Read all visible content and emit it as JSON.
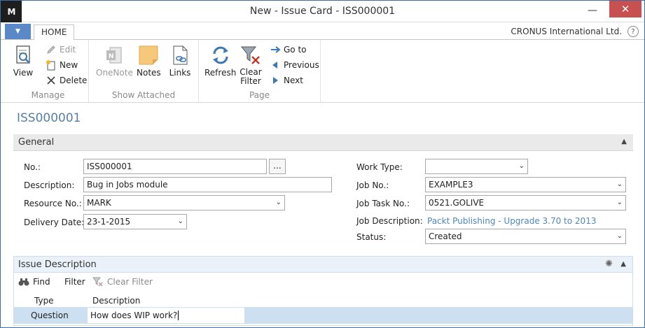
{
  "window": {
    "title": "New - Issue Card - ISS000001",
    "logo": "M",
    "minimize_icon": "minimize-icon",
    "close_icon": "close-icon"
  },
  "ribbon": {
    "file_tab": "▼",
    "home_tab": "HOME",
    "company": "CRONUS International Ltd.",
    "help": "?",
    "groups": {
      "manage": {
        "label": "Manage",
        "view": "View",
        "edit": "Edit",
        "new": "New",
        "delete": "Delete"
      },
      "show_attached": {
        "label": "Show Attached",
        "onenote": "OneNote",
        "notes": "Notes",
        "links": "Links"
      },
      "page": {
        "label": "Page",
        "refresh": "Refresh",
        "clear_filter_1": "Clear",
        "clear_filter_2": "Filter",
        "go_to": "Go to",
        "previous": "Previous",
        "next": "Next"
      }
    }
  },
  "page": {
    "heading": "ISS000001"
  },
  "general": {
    "title": "General",
    "fields": {
      "no_label": "No.:",
      "no_value": "ISS000001",
      "assist": "...",
      "description_label": "Description:",
      "description_value": "Bug in Jobs module",
      "resource_label": "Resource No.:",
      "resource_value": "MARK",
      "delivery_label": "Delivery Date:",
      "delivery_value": "23-1-2015",
      "work_type_label": "Work Type:",
      "work_type_value": "",
      "job_no_label": "Job No.:",
      "job_no_value": "EXAMPLE3",
      "job_task_label": "Job Task No.:",
      "job_task_value": "0521.GOLIVE",
      "job_desc_label": "Job Description:",
      "job_desc_value": "Packt Publishing - Upgrade 3.70 to 2013",
      "status_label": "Status:",
      "status_value": "Created"
    }
  },
  "issue_description": {
    "title": "Issue Description",
    "actions": {
      "find": "Find",
      "filter": "Filter",
      "clear_filter": "Clear Filter"
    },
    "columns": [
      "Type",
      "Description"
    ],
    "rows": [
      {
        "type": "Question",
        "description": "How does WIP work?"
      }
    ]
  },
  "colors": {
    "accent": "#5b89c8",
    "heading": "#5a7fa6",
    "link": "#4f86bd",
    "selected_row": "#cde0f2",
    "close": "#c75050"
  }
}
